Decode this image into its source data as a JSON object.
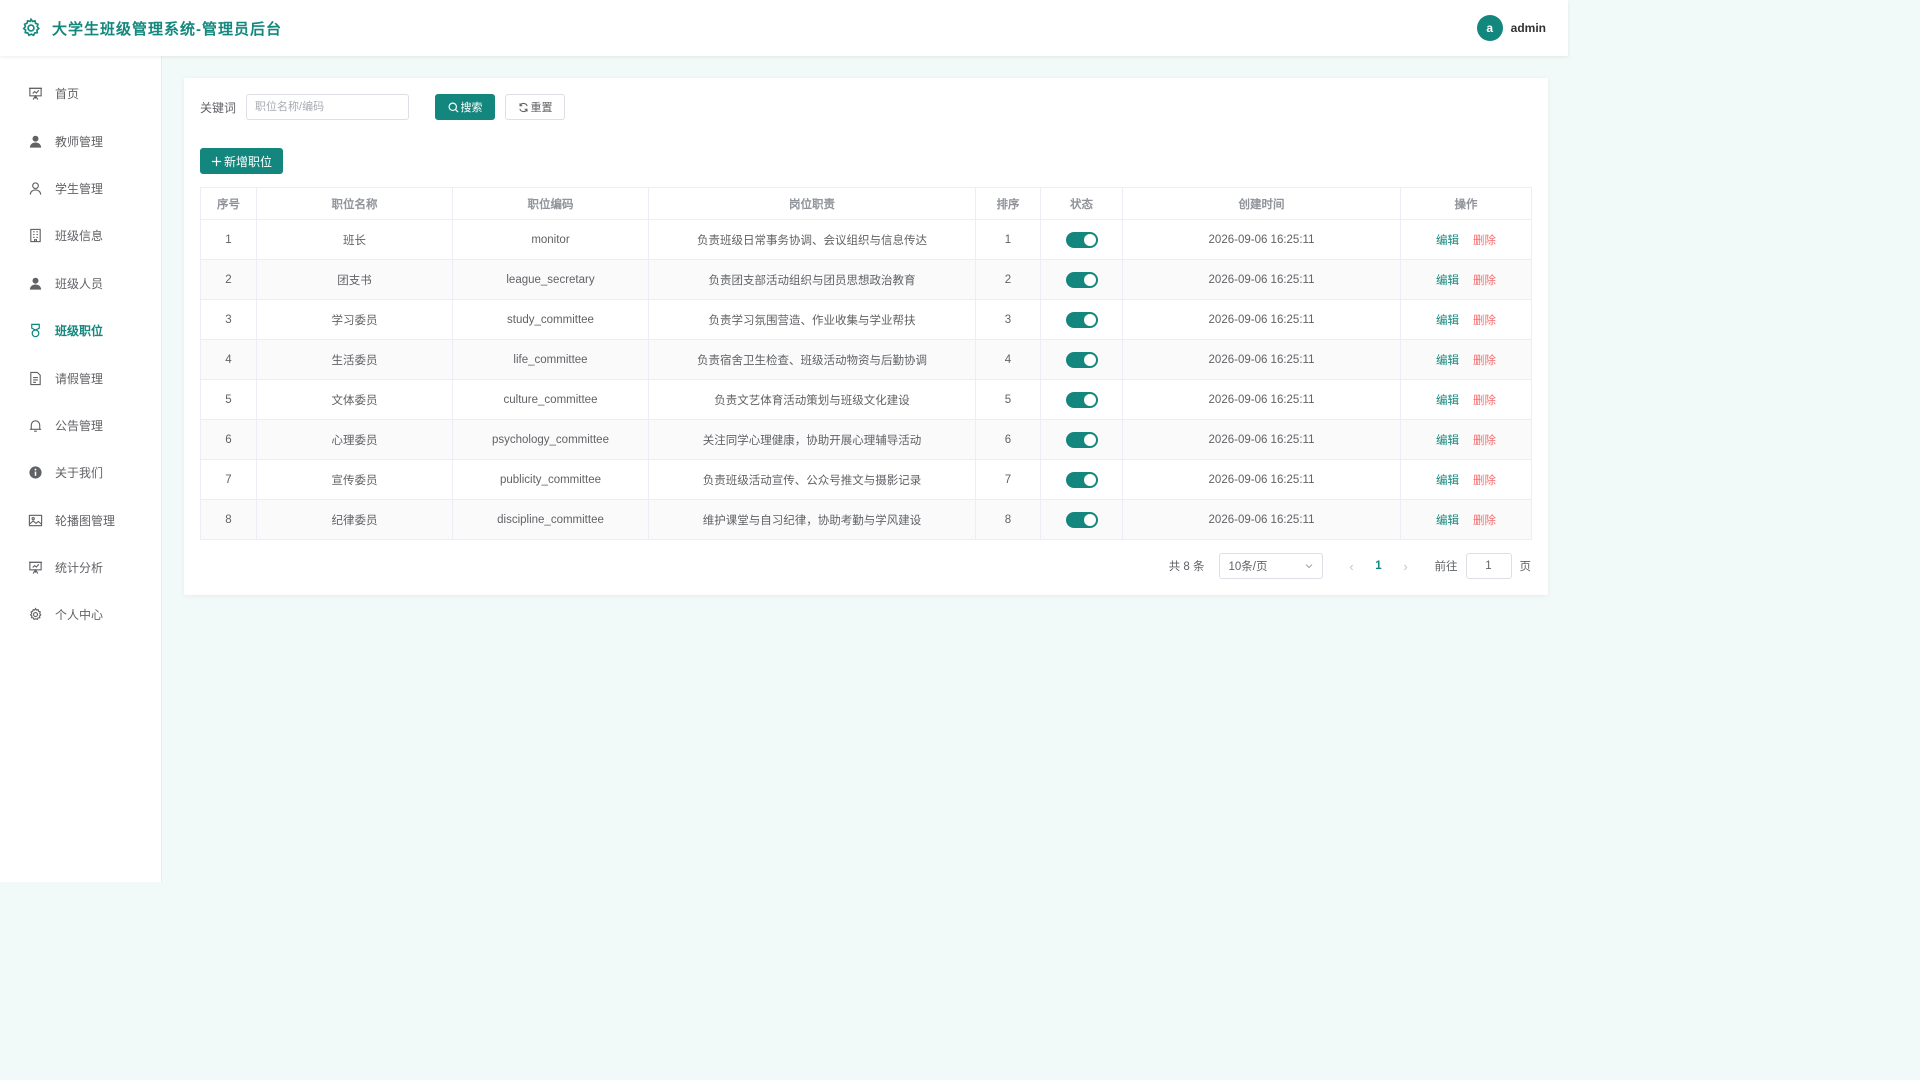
{
  "header": {
    "title": "大学生班级管理系统-管理员后台",
    "avatar_letter": "a",
    "username": "admin"
  },
  "sidebar": {
    "items": [
      {
        "label": "首页",
        "icon": "presentation-icon",
        "active": false
      },
      {
        "label": "教师管理",
        "icon": "user-filled-icon",
        "active": false
      },
      {
        "label": "学生管理",
        "icon": "user-outline-icon",
        "active": false
      },
      {
        "label": "班级信息",
        "icon": "building-icon",
        "active": false
      },
      {
        "label": "班级人员",
        "icon": "user-filled-icon",
        "active": false
      },
      {
        "label": "班级职位",
        "icon": "medal-icon",
        "active": true
      },
      {
        "label": "请假管理",
        "icon": "document-icon",
        "active": false
      },
      {
        "label": "公告管理",
        "icon": "bell-icon",
        "active": false
      },
      {
        "label": "关于我们",
        "icon": "info-icon",
        "active": false
      },
      {
        "label": "轮播图管理",
        "icon": "picture-icon",
        "active": false
      },
      {
        "label": "统计分析",
        "icon": "presentation-icon",
        "active": false
      },
      {
        "label": "个人中心",
        "icon": "gear-icon",
        "active": false
      }
    ]
  },
  "filter": {
    "keyword_label": "关键词",
    "keyword_placeholder": "职位名称/编码",
    "keyword_value": "",
    "search_label": "搜索",
    "reset_label": "重置",
    "add_label": "新增职位"
  },
  "table": {
    "headers": [
      "序号",
      "职位名称",
      "职位编码",
      "岗位职责",
      "排序",
      "状态",
      "创建时间",
      "操作"
    ],
    "edit_label": "编辑",
    "delete_label": "删除",
    "rows": [
      {
        "index": "1",
        "name": "班长",
        "code": "monitor",
        "duty": "负责班级日常事务协调、会议组织与信息传达",
        "sort": "1",
        "enabled": true,
        "created": "2026-09-06 16:25:11"
      },
      {
        "index": "2",
        "name": "团支书",
        "code": "league_secretary",
        "duty": "负责团支部活动组织与团员思想政治教育",
        "sort": "2",
        "enabled": true,
        "created": "2026-09-06 16:25:11"
      },
      {
        "index": "3",
        "name": "学习委员",
        "code": "study_committee",
        "duty": "负责学习氛围营造、作业收集与学业帮扶",
        "sort": "3",
        "enabled": true,
        "created": "2026-09-06 16:25:11"
      },
      {
        "index": "4",
        "name": "生活委员",
        "code": "life_committee",
        "duty": "负责宿舍卫生检查、班级活动物资与后勤协调",
        "sort": "4",
        "enabled": true,
        "created": "2026-09-06 16:25:11"
      },
      {
        "index": "5",
        "name": "文体委员",
        "code": "culture_committee",
        "duty": "负责文艺体育活动策划与班级文化建设",
        "sort": "5",
        "enabled": true,
        "created": "2026-09-06 16:25:11"
      },
      {
        "index": "6",
        "name": "心理委员",
        "code": "psychology_committee",
        "duty": "关注同学心理健康，协助开展心理辅导活动",
        "sort": "6",
        "enabled": true,
        "created": "2026-09-06 16:25:11"
      },
      {
        "index": "7",
        "name": "宣传委员",
        "code": "publicity_committee",
        "duty": "负责班级活动宣传、公众号推文与摄影记录",
        "sort": "7",
        "enabled": true,
        "created": "2026-09-06 16:25:11"
      },
      {
        "index": "8",
        "name": "纪律委员",
        "code": "discipline_committee",
        "duty": "维护课堂与自习纪律，协助考勤与学风建设",
        "sort": "8",
        "enabled": true,
        "created": "2026-09-06 16:25:11"
      }
    ]
  },
  "pagination": {
    "total_text": "共 8 条",
    "page_size": "10条/页",
    "current_page": "1",
    "goto_label": "前往",
    "goto_value": "1",
    "page_suffix": "页"
  },
  "colors": {
    "primary": "#13877d",
    "danger": "#f56c6c",
    "background": "#f2faf9"
  }
}
